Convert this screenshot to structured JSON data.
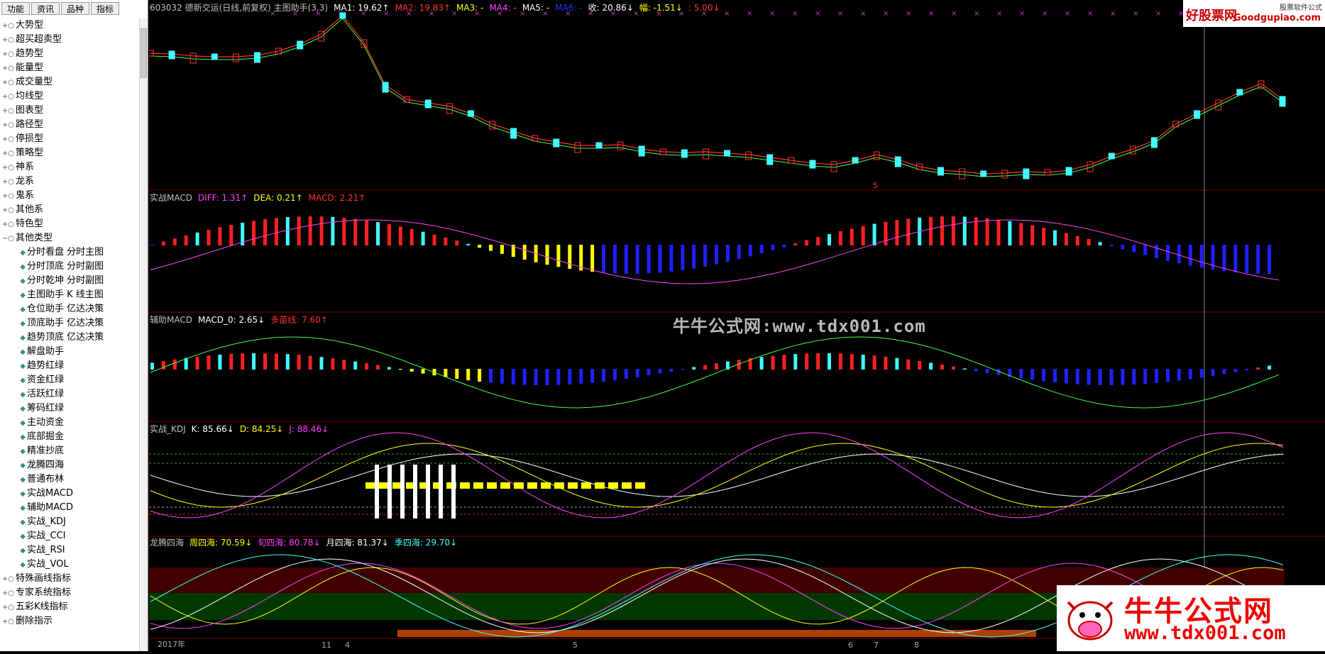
{
  "sidebar": {
    "tabs": [
      "功能",
      "资讯",
      "品种",
      "指标"
    ],
    "top_items": [
      "大势型",
      "超买超卖型",
      "趋势型",
      "能量型",
      "成交量型",
      "均线型",
      "图表型",
      "路径型",
      "停损型",
      "策略型",
      "神系",
      "龙系",
      "鬼系",
      "其他系",
      "特色型"
    ],
    "open_group": "其他类型",
    "children": [
      "分时看盘 分时主图",
      "分时顶底 分时副图",
      "分时乾坤 分时副图",
      "主图助手 K 线主图",
      "仓位助手 亿达决策",
      "顶底助手 亿达决策",
      "趋势顶底 亿达决策",
      "解盘助手",
      "趋势红绿",
      "资金红绿",
      "活跃红绿",
      "筹码红绿",
      "主动资金",
      "底部掘金",
      "精准抄底",
      "龙腾四海",
      "普通布林",
      "实战MACD",
      "辅助MACD",
      "实战_KDJ",
      "实战_CCI",
      "实战_RSI",
      "实战_VOL"
    ],
    "selected_child": "龙腾四海",
    "bottom_items": [
      "特殊画线指标",
      "专家系统指标",
      "五彩K线指标",
      "删除指示"
    ]
  },
  "panels": {
    "main": {
      "title": "603032 德新交运(日线,前复权) 主图助手(3,3)",
      "fields": [
        {
          "label": "MA1: 19.62",
          "arrow": "↑",
          "color": "#ffffff"
        },
        {
          "label": "MA2: 19.83",
          "arrow": "↑",
          "color": "#ff3030"
        },
        {
          "label": "MA3: -",
          "arrow": "",
          "color": "#ffff00"
        },
        {
          "label": "MA4: -",
          "arrow": "",
          "color": "#ff40ff"
        },
        {
          "label": "MA5: -",
          "arrow": "",
          "color": "#ffffff"
        },
        {
          "label": "MA6: -",
          "arrow": "",
          "color": "#3030ff"
        },
        {
          "label": "收: 20.86",
          "arrow": "↓",
          "color": "#ffffff"
        },
        {
          "label": "幅: -1.51",
          "arrow": "↓",
          "color": "#ffff00"
        },
        {
          "label": ": 5.00",
          "arrow": "↓",
          "color": "#ff3030"
        }
      ]
    },
    "macd": {
      "title": "实战MACD",
      "fields": [
        {
          "label": "DIFF: 1.31",
          "arrow": "↑",
          "color": "#ff40ff"
        },
        {
          "label": "DEA: 0.21",
          "arrow": "↑",
          "color": "#ffff00"
        },
        {
          "label": "MACD: 2.21",
          "arrow": "↑",
          "color": "#ff3030"
        }
      ]
    },
    "aux": {
      "title": "辅助MACD",
      "fields": [
        {
          "label": "MACD_0: 2.65",
          "arrow": "↓",
          "color": "#ffffff"
        },
        {
          "label": "多苗线: 7.60",
          "arrow": "↑",
          "color": "#ff3030"
        }
      ]
    },
    "kdj": {
      "title": "实战_KDJ",
      "fields": [
        {
          "label": "K: 85.66",
          "arrow": "↓",
          "color": "#ffffff"
        },
        {
          "label": "D: 84.25",
          "arrow": "↓",
          "color": "#ffff00"
        },
        {
          "label": "J: 88.46",
          "arrow": "↓",
          "color": "#ff40ff"
        }
      ]
    },
    "ltsh": {
      "title": "龙腾四海",
      "fields": [
        {
          "label": "周四海: 70.59",
          "arrow": "↓",
          "color": "#ffff00"
        },
        {
          "label": "旬四海: 80.78",
          "arrow": "↓",
          "color": "#ff40ff"
        },
        {
          "label": "月四海: 81.37",
          "arrow": "↓",
          "color": "#ffffff"
        },
        {
          "label": "季四海: 29.70",
          "arrow": "↓",
          "color": "#40ffff"
        }
      ]
    }
  },
  "x_axis_labels": [
    "2017年",
    "11",
    "4",
    "5",
    "6",
    "7",
    "8"
  ],
  "watermark": "牛牛公式网:www.tdx001.com",
  "logo_top": {
    "cn": "好股票网",
    "en": "Goodgupiao.com",
    "tag": "股票软件公式"
  },
  "logo_bottom": {
    "cn": "牛牛公式网",
    "en": "www.tdx001.com"
  },
  "signal_s": "S"
}
